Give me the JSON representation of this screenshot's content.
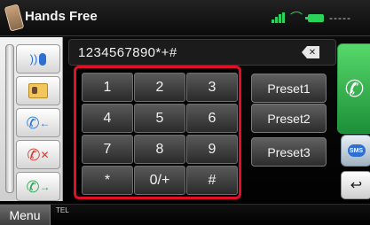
{
  "header": {
    "title": "Hands Free",
    "status_text": "-----"
  },
  "left_panel": {
    "buttons": [
      {
        "name": "voice-dial",
        "icon": "voice-mic-icon"
      },
      {
        "name": "phonebook",
        "icon": "phonebook-card-icon"
      },
      {
        "name": "incoming-calls",
        "icon": "incoming-call-icon"
      },
      {
        "name": "missed-calls",
        "icon": "missed-call-icon"
      },
      {
        "name": "outgoing-calls",
        "icon": "outgoing-call-icon"
      }
    ]
  },
  "number_field": {
    "value": "1234567890*+#",
    "backspace_symbol": "✕"
  },
  "keypad": {
    "keys": [
      "1",
      "2",
      "3",
      "4",
      "5",
      "6",
      "7",
      "8",
      "9",
      "*",
      "0/+",
      "#"
    ],
    "highlight_color": "#e10f27"
  },
  "presets": [
    "Preset1",
    "Preset2",
    "Preset3"
  ],
  "right_buttons": {
    "sms_label": "SMS",
    "back_symbol": "↩"
  },
  "bottom": {
    "menu_label": "Menu",
    "tel_label": "TEL"
  },
  "icons": {
    "handset": "✆",
    "voice_waves": "))",
    "missed_x": "✕",
    "incoming_arrow": "←",
    "outgoing_arrow": "→"
  },
  "colors": {
    "call_green": "#2bd35a",
    "accent_blue": "#2f6fd1",
    "missed_red": "#d43b2f"
  }
}
